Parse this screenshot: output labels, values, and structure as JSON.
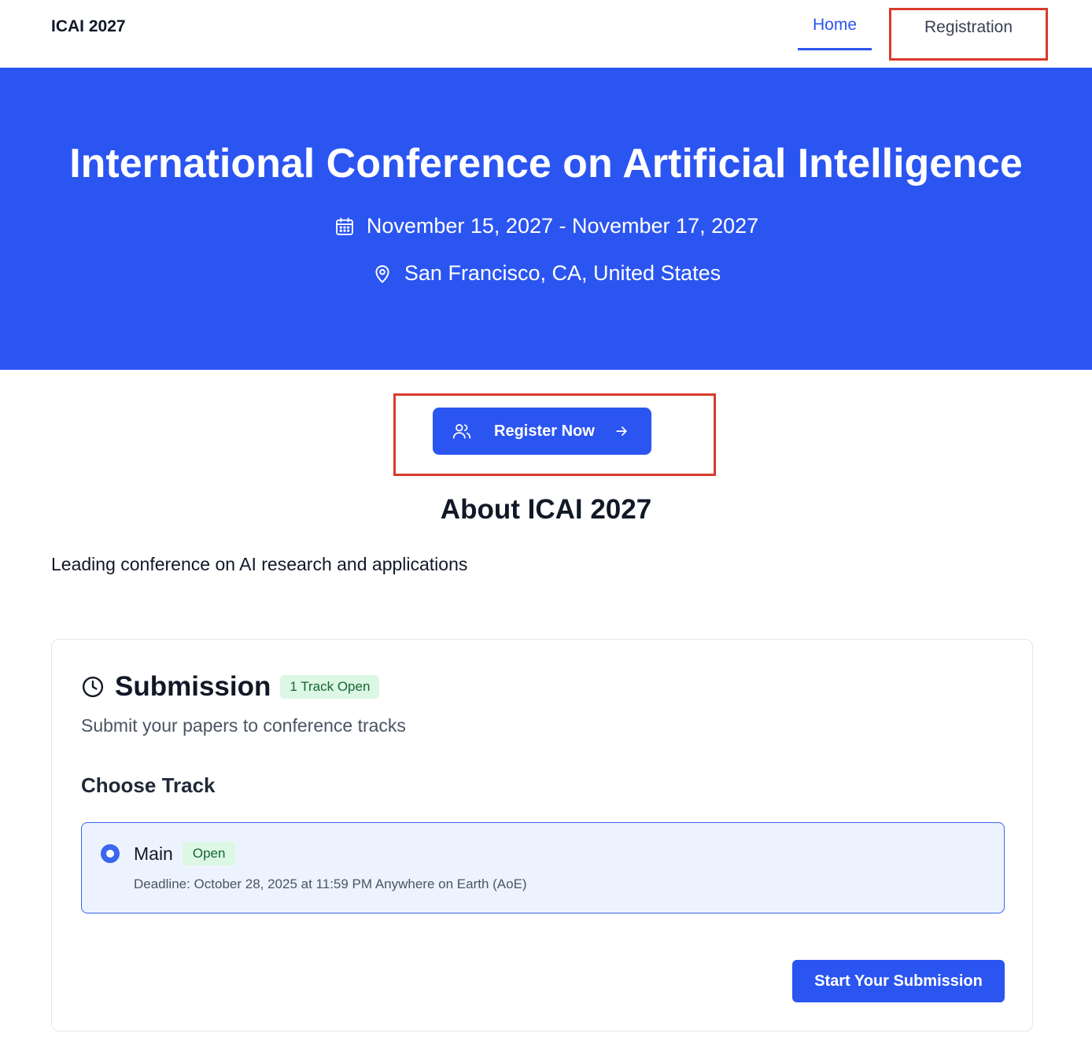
{
  "nav": {
    "brand": "ICAI 2027",
    "home": "Home",
    "registration": "Registration"
  },
  "hero": {
    "title": "International Conference on Artificial Intelligence",
    "dates": "November 15, 2027 - November 17, 2027",
    "location": "San Francisco, CA, United States",
    "date_icon": "calendar-icon",
    "location_icon": "map-pin-icon"
  },
  "register": {
    "label": "Register Now",
    "icon": "users-icon",
    "trailing_icon": "arrow-right-icon"
  },
  "about": {
    "title": "About ICAI 2027",
    "description": "Leading conference on AI research and applications"
  },
  "submission": {
    "icon": "clock-icon",
    "title": "Submission",
    "badge": "1 Track Open",
    "subtitle": "Submit your papers to conference tracks",
    "choose_track": "Choose Track",
    "tracks": [
      {
        "name": "Main",
        "status": "Open",
        "deadline": "Deadline: October 28, 2025 at 11:59 PM Anywhere on Earth (AoE)",
        "selected": true
      }
    ],
    "start_button": "Start Your Submission"
  },
  "colors": {
    "primary": "#2b55f1",
    "highlight_border": "#d93a2b",
    "badge_green_bg": "#dcf7e3",
    "badge_green_text": "#166534"
  }
}
